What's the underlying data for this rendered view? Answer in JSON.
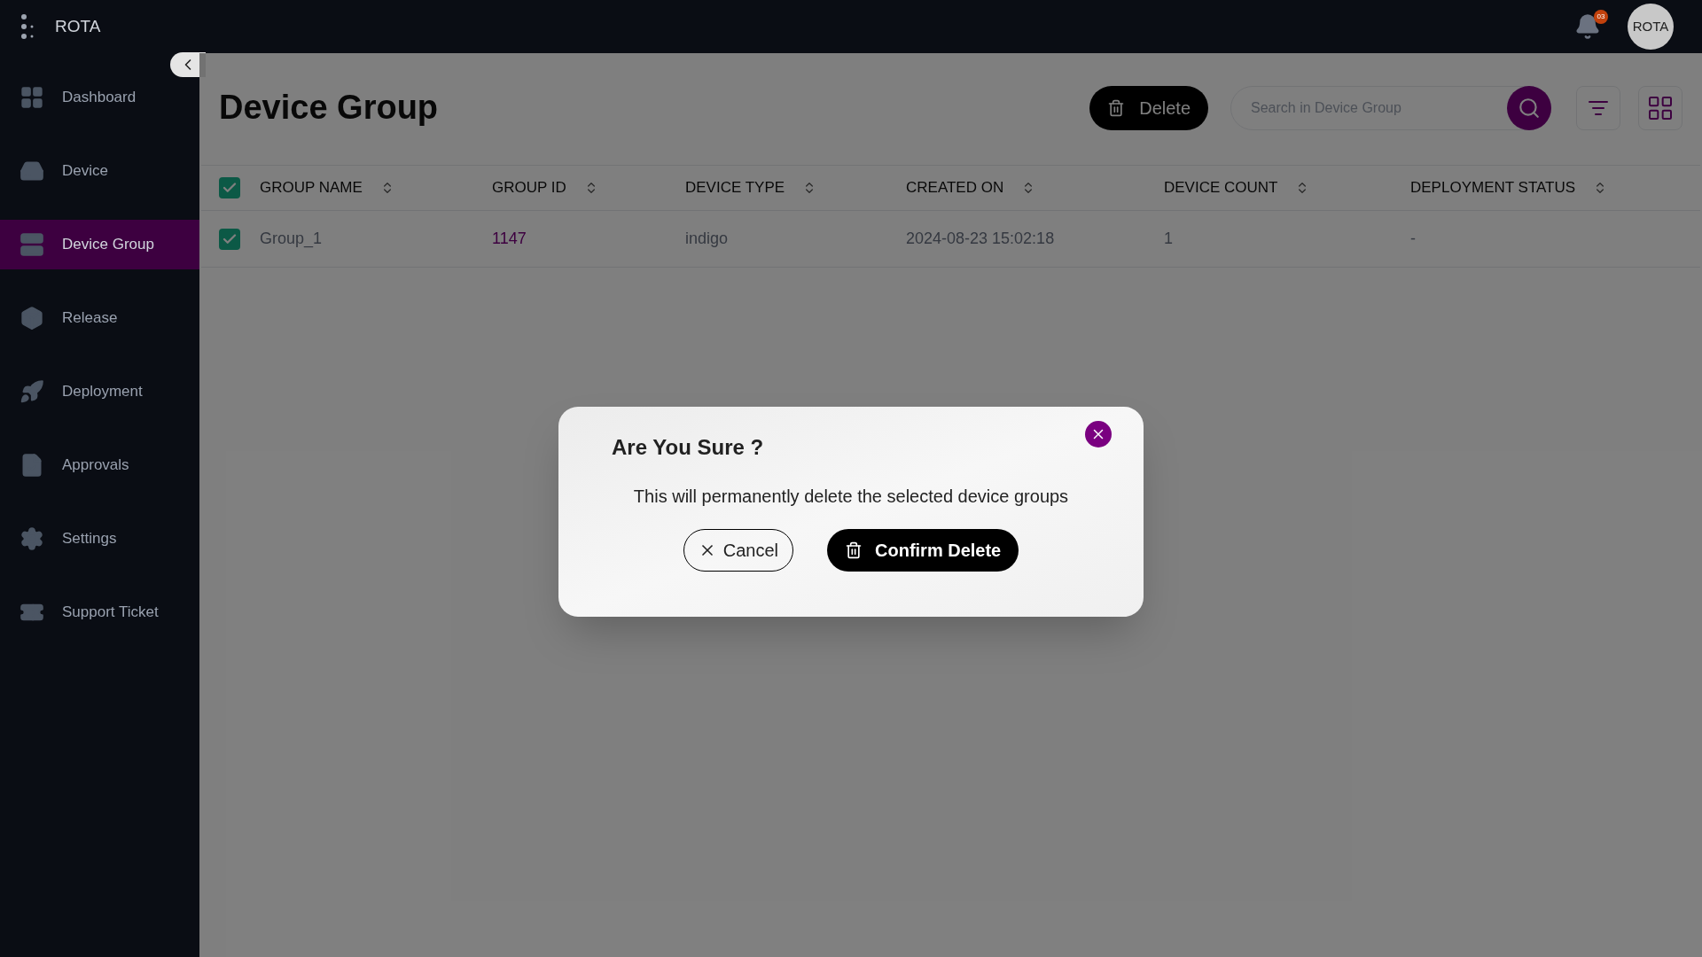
{
  "app": {
    "name": "ROTA",
    "notifications_badge": "03",
    "avatar_text": "ROTA"
  },
  "sidebar": {
    "items": [
      {
        "label": "Dashboard",
        "selected": false
      },
      {
        "label": "Device",
        "selected": false
      },
      {
        "label": "Device Group",
        "selected": true
      },
      {
        "label": "Release",
        "selected": false
      },
      {
        "label": "Deployment",
        "selected": false
      },
      {
        "label": "Approvals",
        "selected": false
      },
      {
        "label": "Settings",
        "selected": false
      },
      {
        "label": "Support Ticket",
        "selected": false
      }
    ]
  },
  "page": {
    "title": "Device Group",
    "delete_button": "Delete",
    "search": {
      "placeholder": "Search in Device Group"
    }
  },
  "table": {
    "all_checked": true,
    "columns": [
      "GROUP NAME",
      "GROUP ID",
      "DEVICE TYPE",
      "CREATED ON",
      "DEVICE COUNT",
      "DEPLOYMENT STATUS"
    ],
    "rows": [
      {
        "checked": true,
        "cells": [
          "Group_1",
          "1147",
          "indigo",
          "2024-08-23 15:02:18",
          "1",
          "-"
        ]
      }
    ]
  },
  "dialog": {
    "title": "Are You Sure ?",
    "message": "This will permanently delete the selected device groups",
    "cancel": "Cancel",
    "confirm": "Confirm Delete"
  }
}
